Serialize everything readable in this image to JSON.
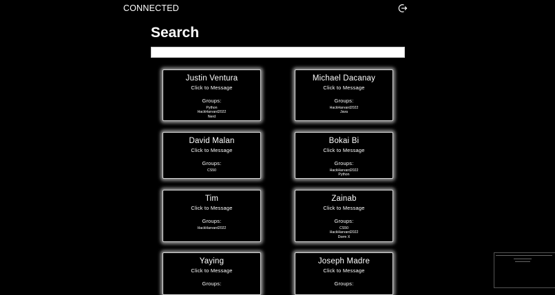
{
  "header": {
    "brand": "CONNECTED",
    "logout_icon": "logout-icon"
  },
  "page": {
    "title": "Search"
  },
  "search": {
    "placeholder": "",
    "value": ""
  },
  "cards_common": {
    "cta": "Click to Message",
    "groups_label": "Groups:"
  },
  "users": [
    {
      "name": "Justin Ventura",
      "groups": [
        "Python",
        "HackHarvard2022",
        "Nerd"
      ]
    },
    {
      "name": "Michael Dacanay",
      "groups": [
        "HackHarvard2022",
        "Java"
      ]
    },
    {
      "name": "David Malan",
      "groups": [
        "CS50"
      ]
    },
    {
      "name": "Bokai Bi",
      "groups": [
        "HackHarvard2022",
        "Python"
      ]
    },
    {
      "name": "Tim",
      "groups": [
        "HackHarvard2022"
      ]
    },
    {
      "name": "Zainab",
      "groups": [
        "CS50",
        "HackHarvard2022",
        "Dorm X"
      ]
    },
    {
      "name": "Yaying",
      "groups": []
    },
    {
      "name": "Joseph Madre",
      "groups": []
    }
  ]
}
